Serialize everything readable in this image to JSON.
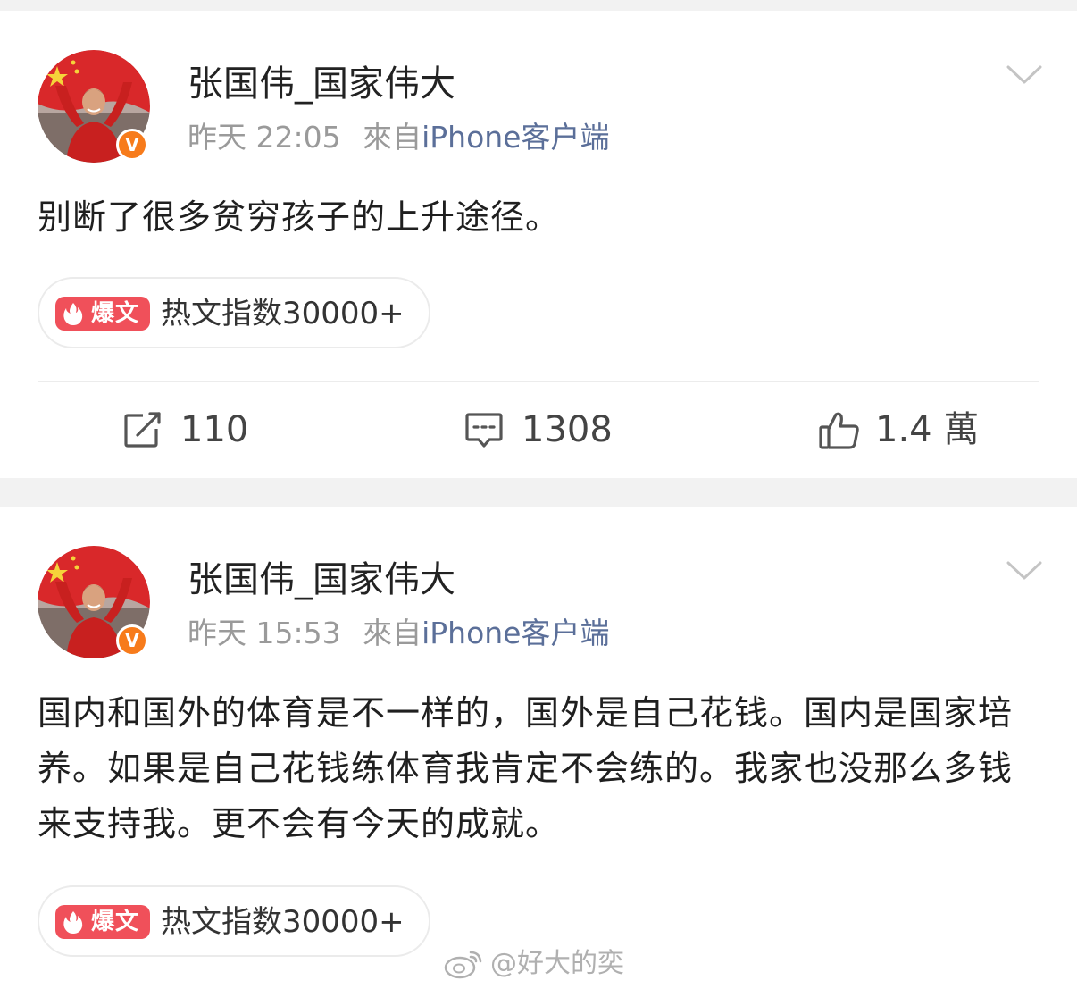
{
  "posts": [
    {
      "username": "张国伟_国家伟大",
      "time": "昨天 22:05",
      "from_label": "來自",
      "source": "iPhone客户端",
      "verified_badge": "V",
      "text": "别断了很多贫穷孩子的上升途径。",
      "hot_badge": "爆文",
      "hot_text": "热文指数30000+",
      "actions": {
        "repost_icon": "repost-icon",
        "repost_count": "110",
        "comment_icon": "comment-icon",
        "comment_count": "1308",
        "like_icon": "thumbs-up-icon",
        "like_count": "1.4 萬"
      }
    },
    {
      "username": "张国伟_国家伟大",
      "time": "昨天 15:53",
      "from_label": "來自",
      "source": "iPhone客户端",
      "verified_badge": "V",
      "text": "国内和国外的体育是不一样的，国外是自己花钱。国内是国家培养。如果是自己花钱练体育我肯定不会练的。我家也没那么多钱来支持我。更不会有今天的成就。",
      "hot_badge": "爆文",
      "hot_text": "热文指数30000+"
    }
  ],
  "watermark": "@好大的奕",
  "colors": {
    "accent_source": "#5b6f99",
    "verified_orange": "#f77b1b",
    "hot_red": "#f0505a",
    "background_gap": "#f2f2f2"
  }
}
